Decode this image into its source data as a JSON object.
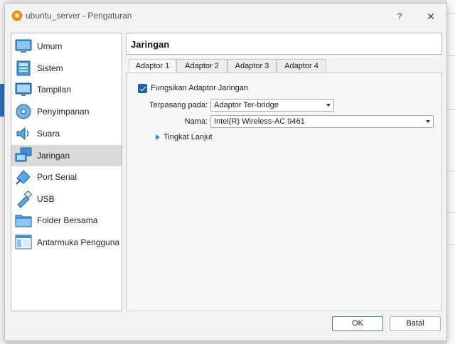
{
  "window": {
    "title": "ubuntu_server - Pengaturan",
    "help_label": "?",
    "close_label": "✕"
  },
  "sidebar": {
    "items": [
      {
        "label": "Umum",
        "icon": "general-icon"
      },
      {
        "label": "Sistem",
        "icon": "system-icon"
      },
      {
        "label": "Tampilan",
        "icon": "display-icon"
      },
      {
        "label": "Penyimpanan",
        "icon": "storage-icon"
      },
      {
        "label": "Suara",
        "icon": "audio-icon"
      },
      {
        "label": "Jaringan",
        "icon": "network-icon",
        "selected": true
      },
      {
        "label": "Port Serial",
        "icon": "serial-port-icon"
      },
      {
        "label": "USB",
        "icon": "usb-icon"
      },
      {
        "label": "Folder Bersama",
        "icon": "shared-folder-icon"
      },
      {
        "label": "Antarmuka Pengguna",
        "icon": "user-interface-icon"
      }
    ]
  },
  "page": {
    "title": "Jaringan"
  },
  "tabs": [
    "Adaptor 1",
    "Adaptor 2",
    "Adaptor 3",
    "Adaptor 4"
  ],
  "adapter": {
    "enable_label": "Fungsikan Adaptor Jaringan",
    "enabled": true,
    "attached_label": "Terpasang pada:",
    "attached_value": "Adaptor Ter-bridge",
    "name_label": "Nama:",
    "name_value": "Intel(R) Wireless-AC 9461",
    "advanced_label": "Tingkat Lanjut"
  },
  "buttons": {
    "ok": "OK",
    "cancel": "Batal"
  },
  "colors": {
    "accent": "#1f5fb0",
    "selected_row": "#d9d9d9"
  }
}
